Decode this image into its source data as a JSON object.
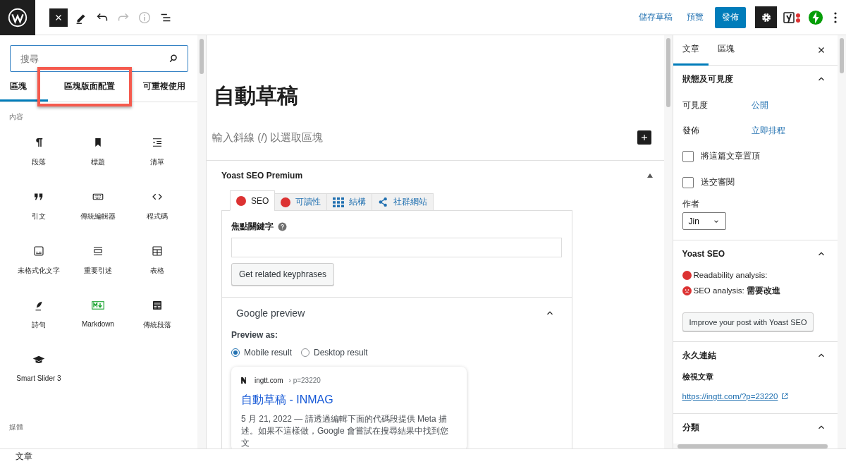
{
  "toolbar": {
    "save_draft": "儲存草稿",
    "preview": "預覽",
    "publish": "發佈"
  },
  "inserter": {
    "search": {
      "placeholder": "搜尋"
    },
    "tabs": [
      {
        "label": "區塊",
        "selected": true,
        "highlighted": false
      },
      {
        "label": "區塊版面配置",
        "selected": false,
        "highlighted": true
      },
      {
        "label": "可重複使用",
        "selected": false,
        "highlighted": false
      }
    ],
    "categories": [
      {
        "title": "內容",
        "blocks": [
          {
            "label": "段落"
          },
          {
            "label": "標題"
          },
          {
            "label": "清單"
          },
          {
            "label": "引文"
          },
          {
            "label": "傳統編輯器"
          },
          {
            "label": "程式碼"
          },
          {
            "label": "未格式化文字"
          },
          {
            "label": "重要引述"
          },
          {
            "label": "表格"
          },
          {
            "label": "詩句"
          },
          {
            "label": "Markdown"
          },
          {
            "label": "傳統段落"
          },
          {
            "label": "Smart Slider 3"
          }
        ]
      },
      {
        "title": "媒體"
      }
    ]
  },
  "editor": {
    "title": "自動草稿",
    "placeholder": "輸入斜線 (/) 以選取區塊",
    "yoast": {
      "title": "Yoast SEO Premium",
      "expanded": true,
      "tabs": [
        {
          "label": "SEO",
          "kind": "score",
          "color": "#dc3232",
          "selected": true
        },
        {
          "label": "可讀性",
          "kind": "score",
          "color": "#dc3232",
          "selected": false
        },
        {
          "label": "結構",
          "kind": "grid",
          "selected": false
        },
        {
          "label": "社群網站",
          "kind": "share",
          "selected": false
        }
      ],
      "focus_keyphrase": {
        "label": "焦點關鍵字"
      },
      "related_button": "Get related keyphrases",
      "google_preview": {
        "title": "Google preview",
        "expanded": true,
        "preview_as": "Preview as:",
        "options": [
          {
            "label": "Mobile result",
            "selected": true
          },
          {
            "label": "Desktop result",
            "selected": false
          }
        ],
        "card": {
          "site": "ingtt.com",
          "path": "› p=23220",
          "title": "自動草稿 - INMAG",
          "description": "5 月 21, 2022 — 請透過編輯下面的代碼段提供 Meta 描述。如果不這樣做，Google 會嘗試在搜尋結果中找到您文"
        }
      }
    }
  },
  "sidebar": {
    "tabs": [
      {
        "label": "文章",
        "selected": true
      },
      {
        "label": "區塊",
        "selected": false
      }
    ],
    "status": {
      "title": "狀態及可見度",
      "expanded": true,
      "rows": [
        {
          "label": "可見度",
          "value": "公開"
        },
        {
          "label": "發佈",
          "value": "立即排程"
        }
      ],
      "checkboxes": [
        {
          "label": "將這篇文章置頂",
          "checked": false
        },
        {
          "label": "送交審閱",
          "checked": false
        }
      ],
      "author": {
        "label": "作者",
        "value": "Jin"
      }
    },
    "yoast": {
      "title": "Yoast SEO",
      "expanded": true,
      "items": [
        {
          "kind": "dot",
          "text": "Readability analysis:",
          "color": "#dc3232"
        },
        {
          "kind": "face",
          "text": "SEO analysis: **需要改進**",
          "color": "#dc3232"
        }
      ],
      "button": "Improve your post with Yoast SEO"
    },
    "permalink": {
      "title": "永久連結",
      "expanded": true,
      "label": "檢視文章",
      "url": "https://ingtt.com/?p=23220"
    },
    "categories": {
      "title": "分類",
      "expanded": true
    }
  },
  "status_bar": "文章"
}
